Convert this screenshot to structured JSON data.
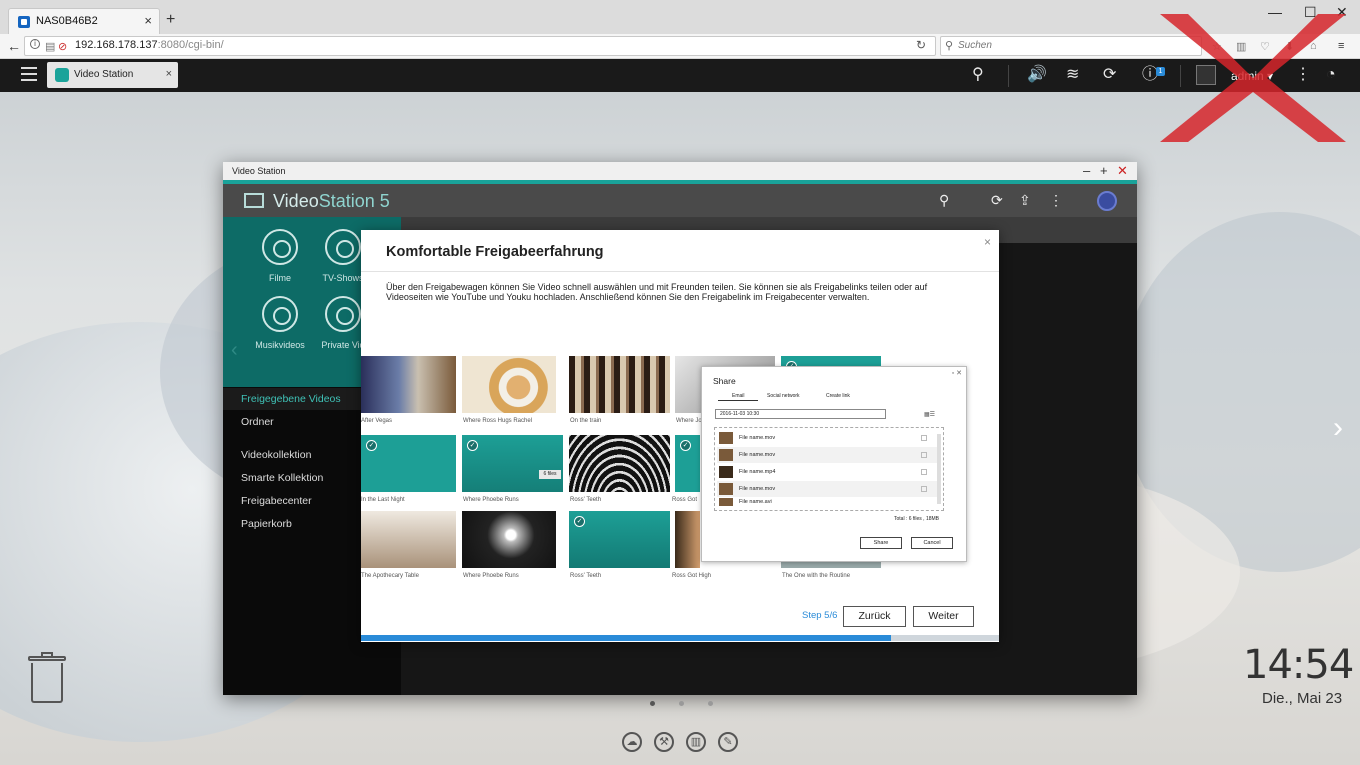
{
  "browser": {
    "tab_title": "NAS0B46B2",
    "tab_close": "×",
    "new_tab": "+",
    "url_host": "192.168.178.137",
    "url_rest": ":8080/cgi-bin/",
    "search_placeholder": "Suchen",
    "controls": {
      "minimize": "—",
      "maximize": "☐",
      "close": "✕"
    }
  },
  "qts": {
    "tab_label": "Video Station",
    "tab_close": "×",
    "user": "admin ▾",
    "info_badge": "1",
    "icons": [
      "search-icon",
      "volume-icon",
      "stack-icon",
      "sync-icon",
      "info-icon",
      "user-icon",
      "more-icon",
      "dashboard-icon"
    ]
  },
  "window": {
    "title": "Video Station",
    "brand_main": "Video",
    "brand_sub": "Station 5",
    "controls": {
      "minimize": "–",
      "maximize": "+",
      "close": "✕"
    }
  },
  "sidebar": {
    "categories": [
      {
        "label": "Filme",
        "icon": "film-reel-icon"
      },
      {
        "label": "TV-Shows",
        "icon": "tv-icon"
      },
      {
        "label": "Musikvideos",
        "icon": "music-icon"
      },
      {
        "label": "Private Vid",
        "icon": "camera-icon"
      }
    ],
    "nav": [
      {
        "label": "Freigegebene Videos",
        "active": true
      },
      {
        "label": "Ordner"
      },
      {
        "label": "Videokollektion"
      },
      {
        "label": "Smarte Kollektion"
      },
      {
        "label": "Freigabecenter"
      },
      {
        "label": "Papierkorb"
      }
    ]
  },
  "dialog": {
    "title": "Komfortable Freigabeerfahrung",
    "close": "×",
    "text": "Über den Freigabewagen können Sie Video schnell auswählen und mit Freunden teilen. Sie können sie als Freigabelinks teilen oder auf Videoseiten wie YouTube und Youku hochladen. Anschließend können Sie den Freigabelink im Freigabecenter verwalten.",
    "thumb_captions": [
      "After Vegas",
      "Where Ross Hugs Rachel",
      "On the train",
      "Where Jo",
      "",
      "In the Last Night",
      "Where Phoebe Runs",
      "Ross' Teeth",
      "Ross Got",
      "The Apothecary Table",
      "Where Phoebe Runs",
      "Ross' Teeth",
      "Ross Got High",
      "The One with the Routine"
    ],
    "files_badge": "6 files",
    "step": "Step 5/6",
    "back_label": "Zurück",
    "next_label": "Weiter",
    "progress": 0.83,
    "share": {
      "title": "Share",
      "tabs": [
        "Email",
        "Social network",
        "Create link"
      ],
      "date": "2016-11-03 10:30",
      "files": [
        "File name.mov",
        "File name.mov",
        "File name.mp4",
        "File name.mov",
        "File name.avi"
      ],
      "total": "Total : 6 files , 18MB",
      "share_btn": "Share",
      "cancel_btn": "Cancel"
    }
  },
  "desktop": {
    "time": "14:54",
    "date": "Die., Mai 23"
  },
  "colors": {
    "accent": "#1aa39a",
    "progress": "#2a8bd8",
    "watermark": "#d6262b"
  }
}
